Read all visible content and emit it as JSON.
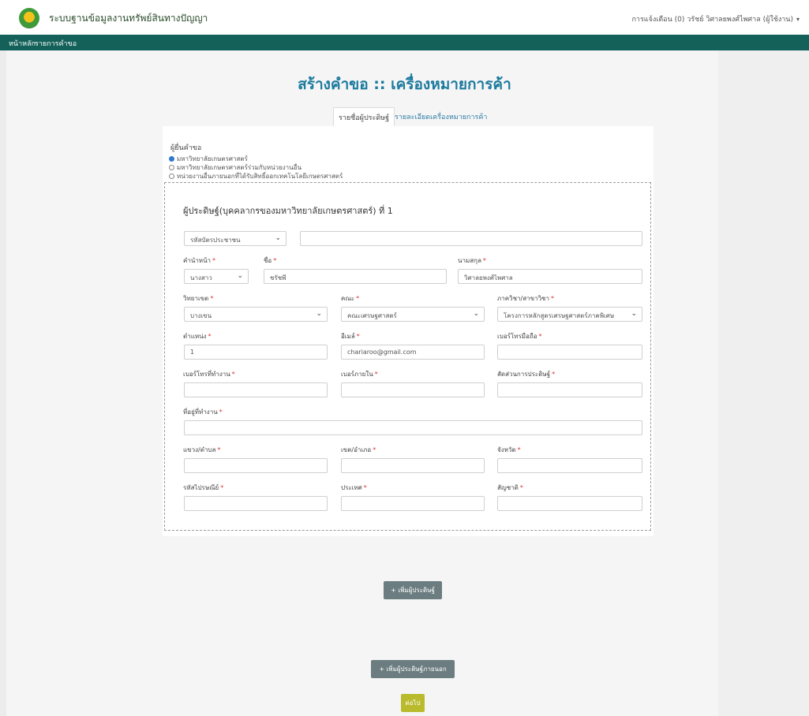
{
  "header": {
    "site_title": "ระบบฐานข้อมูลงานทรัพย์สินทางปัญญา",
    "user_text": "การแจ้งเตือน (0)   วรัชย์ วิศาลยพงศ์ไพศาล (ผู้ใช้งาน)",
    "caret": "▾"
  },
  "nav": {
    "home": "หน้าหลัก",
    "requests": "รายการคำขอ"
  },
  "page": {
    "title": "สร้างคำขอ :: เครื่องหมายการค้า"
  },
  "tabs": [
    {
      "label": "รายชื่อผู้ประดิษฐ์",
      "active": true
    },
    {
      "label": "รายละเอียดเครื่องหมายการค้า",
      "active": false
    }
  ],
  "applicant": {
    "label": "ผู้ยื่นคำขอ",
    "options": [
      {
        "label": "มหาวิทยาลัยเกษตรศาสตร์",
        "selected": true
      },
      {
        "label": "มหาวิทยาลัยเกษตรศาสตร์ร่วมกับหน่วยงานอื่น",
        "selected": false
      },
      {
        "label": "หน่วยงานอื่นภายนอกที่ได้รับสิทธิ์ออกเทคโนโลยีเกษตรศาสตร์",
        "selected": false
      }
    ]
  },
  "inventor": {
    "section_title": "ผู้ประดิษฐ์(บุคคลากรของมหาวิทยาลัยเกษตรศาสตร์) ที่ 1",
    "id_type_value": "รหัสบัตรประชาชน",
    "id_number_value": "",
    "fields": {
      "prefix": {
        "label": "คำนำหน้า",
        "value": "นางสาว"
      },
      "first_name": {
        "label": "ชื่อ",
        "value": "ชรัชพี"
      },
      "last_name": {
        "label": "นามสกุล",
        "value": "วิศาลยพงศ์ไพศาล"
      },
      "campus": {
        "label": "วิทยาเขต",
        "value": "บางเขน"
      },
      "faculty": {
        "label": "คณะ",
        "value": "คณะเศรษฐศาสตร์"
      },
      "department": {
        "label": "ภาควิชา/สาขาวิชา",
        "value": "โครงการหลักสูตรเศรษฐศาสตร์ภาคพิเศษ"
      },
      "position": {
        "label": "ตำแหน่ง",
        "value": "1"
      },
      "email": {
        "label": "อีเมล์",
        "value": "chariaroo@gmail.com"
      },
      "mobile": {
        "label": "เบอร์โทรมือถือ",
        "value": ""
      },
      "office_phone": {
        "label": "เบอร์โทรที่ทำงาน",
        "value": ""
      },
      "share": {
        "label": "เบอร์ภายใน",
        "value": ""
      },
      "ratio": {
        "label": "สัดส่วนการประดิษฐ์",
        "value": ""
      },
      "address": {
        "label": "ที่อยู่ที่ทำงาน",
        "value": ""
      },
      "subdistrict": {
        "label": "แขวง/ตำบล",
        "value": ""
      },
      "district": {
        "label": "เขต/อำเภอ",
        "value": ""
      },
      "province": {
        "label": "จังหวัด",
        "value": ""
      },
      "postcode": {
        "label": "รหัสไปรษณีย์",
        "value": ""
      },
      "country": {
        "label": "ประเทศ",
        "value": ""
      },
      "nationality": {
        "label": "สัญชาติ",
        "value": ""
      }
    }
  },
  "buttons": {
    "add_inventor": "+ เพิ่มผู้ประดิษฐ์",
    "add_external": "+ เพิ่มผู้ประดิษฐ์ภายนอก",
    "next": "ต่อไป"
  },
  "colors": {
    "nav_bg": "#14615a",
    "title": "#1b7a9e",
    "required": "#dd3333",
    "button_grey": "#6b7d80",
    "button_next": "#b9bb2d"
  }
}
